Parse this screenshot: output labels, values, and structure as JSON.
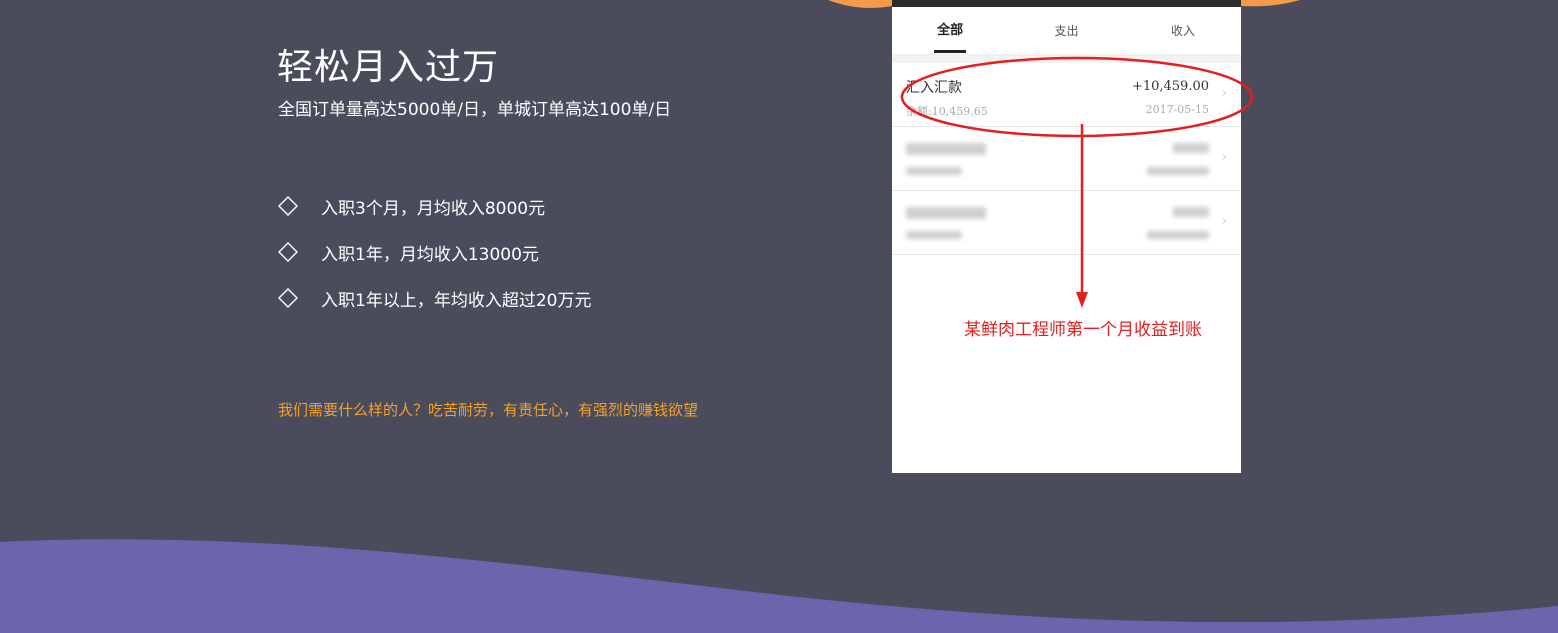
{
  "hero": {
    "title": "轻松月入过万",
    "subtitle": "全国订单量高达5000单/日，单城订单高达100单/日",
    "bullet_icon": "diamond-outline-icon",
    "bullets": [
      "入职3个月，月均收入8000元",
      "入职1年，月均收入13000元",
      "入职1年以上，年均收入超过20万元"
    ],
    "tagline": "我们需要什么样的人？吃苦耐劳，有责任心，有强烈的赚钱欲望"
  },
  "phone": {
    "tabs": [
      "全部",
      "支出",
      "收入"
    ],
    "active_tab": "全部",
    "transactions": [
      {
        "title": "汇入汇款",
        "amount": "+10,459.00",
        "balance": "余额:10,459.65",
        "date": "2017-05-15"
      }
    ]
  },
  "annotation": {
    "text": "某鲜肉工程师第一个月收益到账",
    "color": "#e61e1e"
  },
  "colors": {
    "background": "#4a4c5b",
    "accent_orange": "#f4a12a",
    "wave_purple": "#6c64ad",
    "top_wave_orange": "#f39a4b"
  }
}
